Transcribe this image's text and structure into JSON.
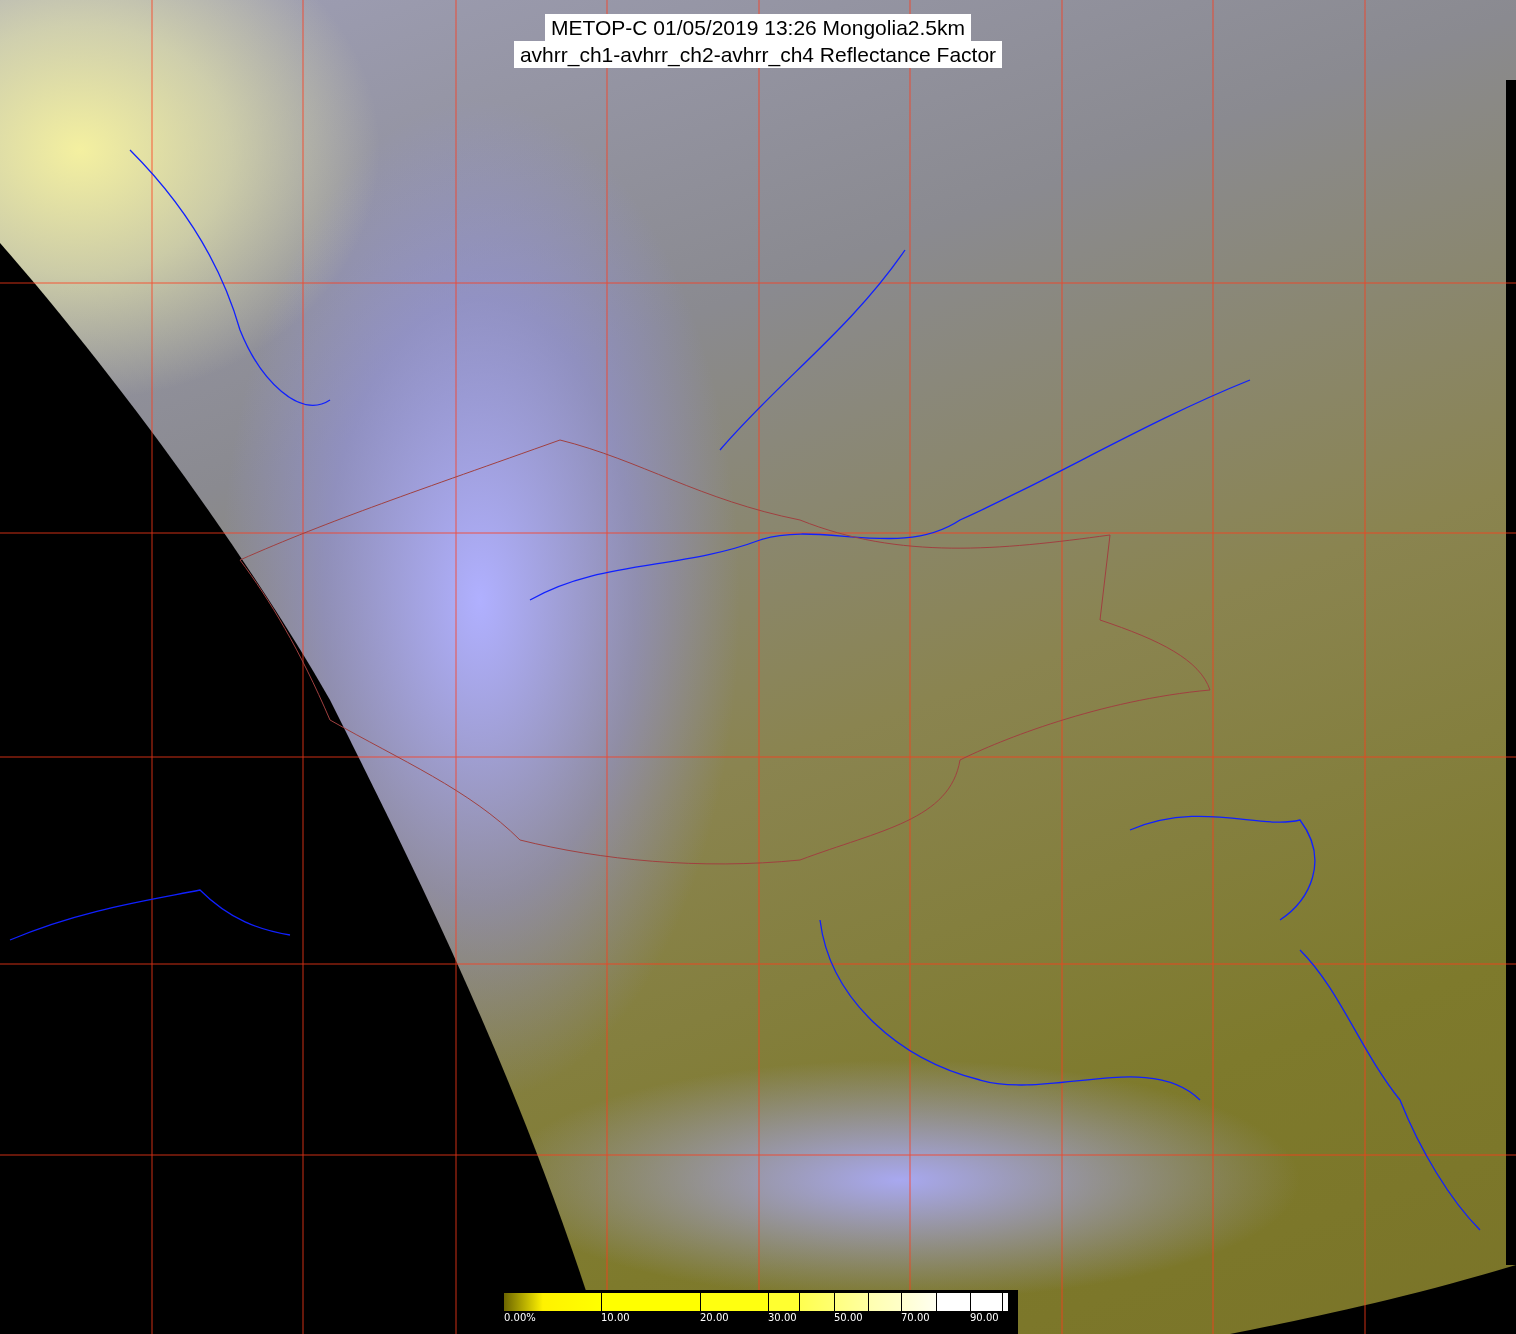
{
  "title_lines": [
    "METOP-C 01/05/2019 13:26 Mongolia2.5km",
    "avhrr_ch1-avhrr_ch2-avhrr_ch4 Reflectance Factor"
  ],
  "color_scale": {
    "labels": [
      "0.00%",
      "10.00",
      "20.00",
      "30.00",
      "50.00",
      "70.00",
      "90.00"
    ]
  }
}
